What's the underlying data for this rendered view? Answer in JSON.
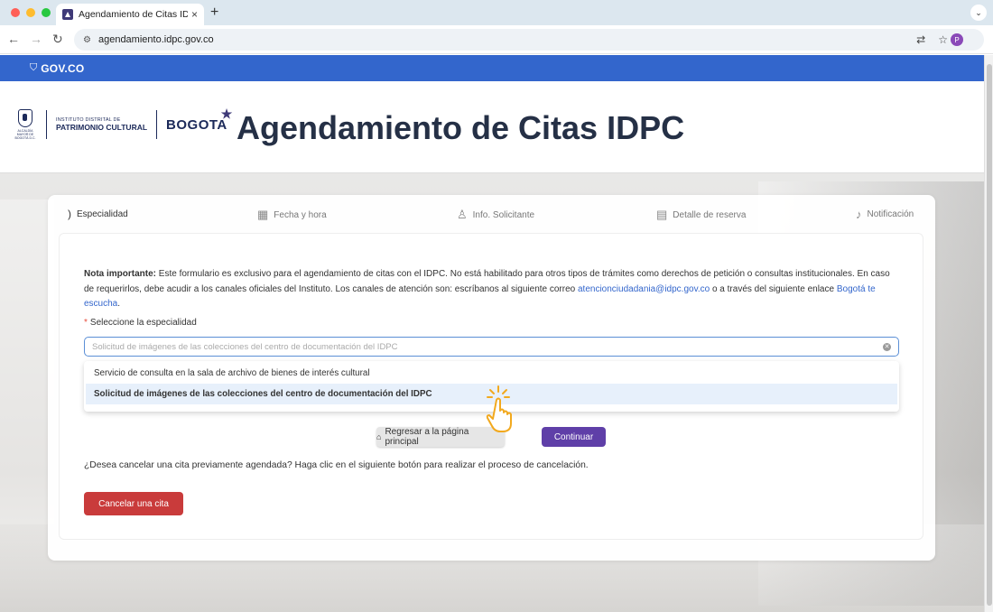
{
  "browser": {
    "tab_title": "Agendamiento de Citas IDPC",
    "tab_close": "×",
    "new_tab": "+",
    "url": "agendamiento.idpc.gov.co",
    "profile_initial": "P",
    "traffic_light_colors": [
      "#ff5f57",
      "#febc2e",
      "#28c840"
    ]
  },
  "gov_bar": {
    "label": "GOV.CO",
    "color": "#3366cc"
  },
  "header": {
    "escudo_caption": "ALCALDÍA MAYOR DE BOGOTÁ D.C.",
    "idpc_line1": "INSTITUTO DISTRITAL DE",
    "idpc_line2": "PATRIMONIO CULTURAL",
    "bogota": "BOGOTA",
    "title": "Agendamiento de Citas IDPC"
  },
  "steps": [
    {
      "label": "Especialidad",
      "icon": "spinner-icon",
      "active": true
    },
    {
      "label": "Fecha y hora",
      "icon": "calendar-icon",
      "active": false
    },
    {
      "label": "Info. Solicitante",
      "icon": "user-icon",
      "active": false
    },
    {
      "label": "Detalle de reserva",
      "icon": "document-icon",
      "active": false
    },
    {
      "label": "Notificación",
      "icon": "bell-icon",
      "active": false
    }
  ],
  "form": {
    "note_bold": "Nota importante:",
    "note_text_1": " Este formulario es exclusivo para el agendamiento de citas con el IDPC. No está habilitado para otros tipos de trámites como derechos de petición o consultas institucionales. En caso de requerirlos, debe acudir a los canales oficiales del Instituto. Los canales de atención son: escríbanos al siguiente correo ",
    "note_email": "atencionciudadania@idpc.gov.co",
    "note_text_2": " o a través del siguiente enlace ",
    "note_link": "Bogotá te escucha",
    "note_end": ".",
    "field_label": "Seleccione la especialidad",
    "required_mark": "*",
    "select_placeholder": "Solicitud de imágenes de las colecciones del centro de documentación del IDPC",
    "options": [
      {
        "label": "Servicio de consulta en la sala de archivo de bienes de interés cultural",
        "selected": false
      },
      {
        "label": "Solicitud de imágenes de las colecciones del centro de documentación del IDPC",
        "selected": true
      }
    ],
    "back_button": "Regresar a la página principal",
    "continue_button": "Continuar",
    "cancel_question": "¿Desea cancelar una cita previamente agendada? Haga clic en el siguiente botón para realizar el proceso de cancelación.",
    "cancel_button": "Cancelar una cita"
  },
  "colors": {
    "continue": "#5f3fa8",
    "cancel": "#c93b3b",
    "title": "#253046",
    "link": "#3366cc"
  }
}
